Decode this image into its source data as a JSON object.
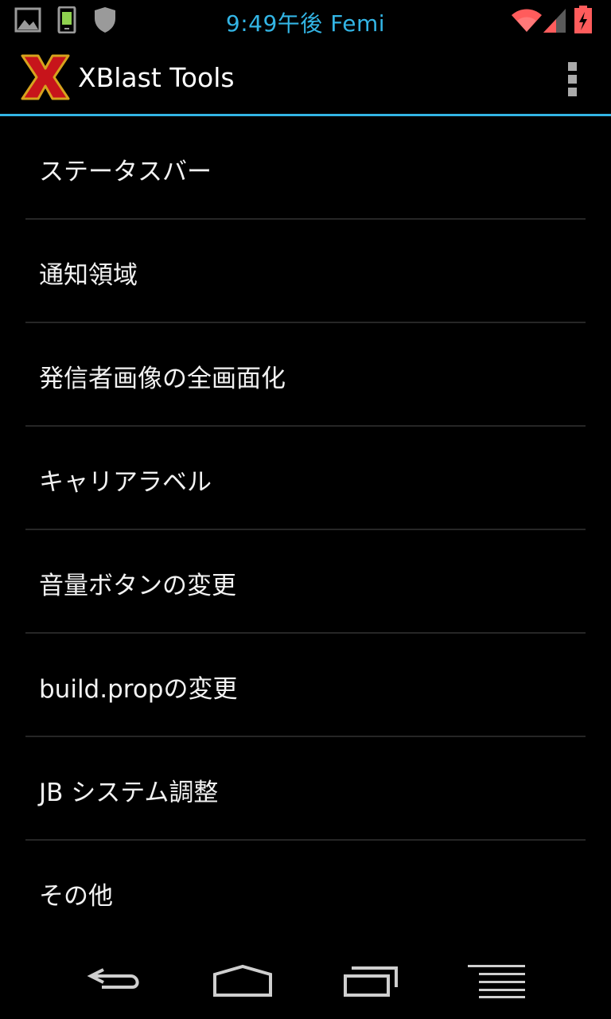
{
  "status_bar": {
    "time_carrier": "9:49午後 Femi",
    "left_icons": [
      "picture-icon",
      "phone-icon",
      "shield-icon"
    ],
    "right_icons": [
      "wifi-icon",
      "signal-icon",
      "battery-charging-icon"
    ],
    "time_color": "#33b5e5",
    "alert_color": "#ff5c5c"
  },
  "action_bar": {
    "title": "XBlast Tools",
    "logo_letter": "X",
    "accent_color": "#33b5e5"
  },
  "menu": {
    "items": [
      {
        "label": "ステータスバー"
      },
      {
        "label": "通知領域"
      },
      {
        "label": "発信者画像の全画面化"
      },
      {
        "label": "キャリアラベル"
      },
      {
        "label": "音量ボタンの変更"
      },
      {
        "label": "build.propの変更"
      },
      {
        "label": "JB システム調整"
      },
      {
        "label": "その他"
      }
    ]
  },
  "nav_bar": {
    "buttons": [
      "back-icon",
      "home-icon",
      "recents-icon",
      "menu-icon"
    ]
  }
}
